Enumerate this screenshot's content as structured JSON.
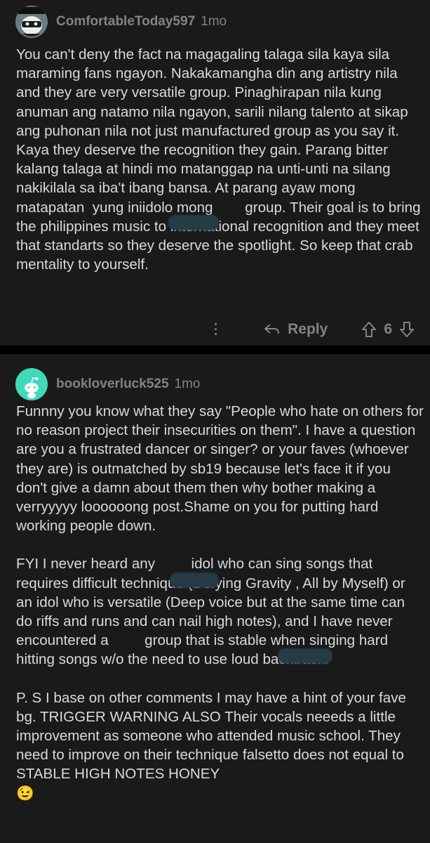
{
  "comments": [
    {
      "username": "ComfortableToday597",
      "age": "1mo",
      "text": "You can't deny the fact na magagaling talaga sila kaya sila maraming fans ngayon. Nakakamangha din ang artistry nila and they are very versatile group. Pinaghirapan nila kung anuman ang natamo nila ngayon, sarili nilang talento at sikap ang puhonan nila not just manufactured group as you say it.  Kaya they deserve the recognition they gain. Parang bitter kalang talaga at hindi mo matanggap na unti-unti na silang nakikilala sa iba't ibang bansa. At parang ayaw mong matapatan  yung iniidolo mong        group. Their goal is to bring the philippines music to international recognition and they meet that standarts so they deserve the spotlight. So keep that crab mentality to yourself.",
      "reply_label": "Reply",
      "votes": "6"
    },
    {
      "username": "bookloverluck525",
      "age": "1mo",
      "paragraphs": [
        "Funnny you know what they say \"People who hate on others for no reason project their insecurities on them\". I have a question are you a frustrated dancer or singer? or your faves (whoever they are) is outmatched by sb19 because let's face it if you don't give a damn about them then why bother making a verryyyyy loooooong post.Shame on you for putting hard working people down.",
        "FYI I never heard any         idol who can sing songs that requires difficult technique (Defying Gravity , All by Myself) or an idol who is versatile (Deep voice but at the same time can do riffs and runs and can nail high notes), and I have never encountered a         group that is stable when singing hard hitting songs w/o the need to use loud backtrack.",
        "P. S I base on other comments I may have a hint of your fave bg. TRIGGER WARNING ALSO Their vocals neeeds a little improvement as someone who attended music school. They need to improve on their technique falsetto does not equal to STABLE HIGH NOTES HONEY",
        "😉"
      ]
    }
  ]
}
